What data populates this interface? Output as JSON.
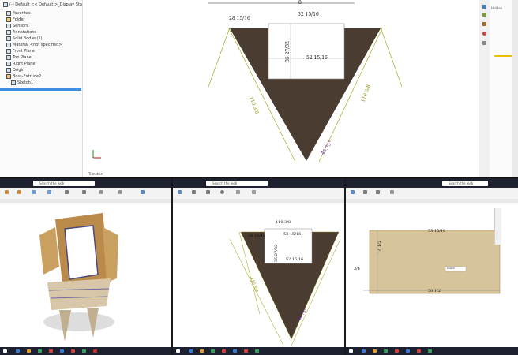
{
  "top": {
    "tree": {
      "root": "(-) Default << Default >_Display Sta",
      "items": [
        "Favorites",
        "Folder",
        "Sensors",
        "Annotations",
        "Solid Bodies(1)",
        "Material <not specified>",
        "Front Plane",
        "Top Plane",
        "Right Plane",
        "Origin",
        "Boss-Extrude2",
        "Sketch1"
      ]
    },
    "dims": {
      "top_left": "28 15/16",
      "top_right": "52 15/16",
      "vertical": "35 27/32",
      "inner": "52 15/16",
      "left_side": "110 3/8",
      "right_side": "110 3/8",
      "angle": "40.75°",
      "top_edge": "8"
    },
    "axis_label": "Trimetric",
    "right_label": "Hidden"
  },
  "panels": [
    {
      "search": "Search the web",
      "name": "panel-left"
    },
    {
      "search": "Search the web",
      "name": "panel-middle",
      "dims": {
        "top": "110 3/8",
        "left": "28 15/16",
        "right": "52 15/16",
        "vertical": "35 27/32",
        "inner": "52 15/16",
        "left_side": "110 3/8",
        "angle": "40.75°"
      }
    },
    {
      "search": "Search the web",
      "name": "panel-right",
      "dims": {
        "top": "53 15/16",
        "left": "14 1/2",
        "small": "3/4",
        "bottom": "50 1/2",
        "tag": "Sketch"
      }
    }
  ]
}
